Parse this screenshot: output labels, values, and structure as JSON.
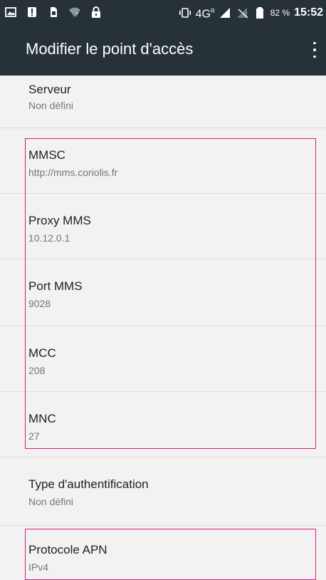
{
  "status_bar": {
    "left_icons": [
      "image-icon",
      "alert-icon",
      "sim-icon",
      "wifi-question-icon",
      "lock-icon"
    ],
    "vibrate_icon": "vibrate-icon",
    "network": "4G",
    "network_superscript": "R",
    "battery_percent": "82 %",
    "time": "15:52"
  },
  "toolbar": {
    "title": "Modifier le point d'accès",
    "menu_icon": "overflow-menu-icon"
  },
  "settings": [
    {
      "title": "Serveur",
      "value": "Non défini"
    },
    {
      "title": "MMSC",
      "value": "http://mms.coriolis.fr"
    },
    {
      "title": "Proxy MMS",
      "value": "10.12.0.1"
    },
    {
      "title": "Port MMS",
      "value": "9028"
    },
    {
      "title": "MCC",
      "value": "208"
    },
    {
      "title": "MNC",
      "value": "27"
    },
    {
      "title": "Type d'authentification",
      "value": "Non défini"
    },
    {
      "title": "Protocole APN",
      "value": "IPv4"
    }
  ],
  "colors": {
    "toolbar": "#263238",
    "background": "#f2f2f2",
    "highlight": "#d81b86",
    "title_text": "#212121",
    "subtitle_text": "#757575"
  }
}
